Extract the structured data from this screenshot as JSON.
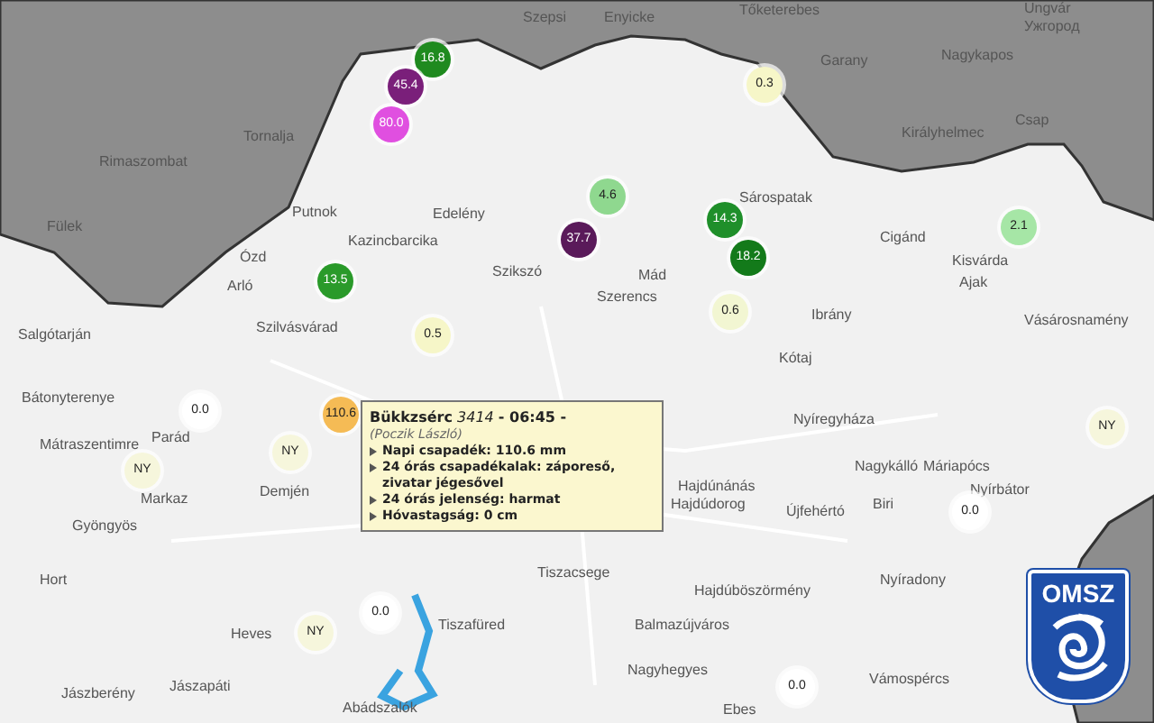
{
  "map": {
    "place_labels": [
      "Enyicke",
      "Tőketerebes",
      "Ungvár",
      "Ужгород",
      "Szepsi",
      "Garany",
      "Nagykapos",
      "Királyhelmec",
      "Csap",
      "Rimaszombat",
      "Tornalja",
      "Fülek",
      "Sárospatak",
      "Cigánd",
      "Kisvárda",
      "Ajak",
      "Putnok",
      "Edelény",
      "Kazincbarcika",
      "Ózd",
      "Arló",
      "Szikszó",
      "Mád",
      "Szerencs",
      "Salgótarján",
      "Szilvásvárad",
      "Ibrány",
      "Vásárosnamény",
      "Kótaj",
      "Bátonyterenye",
      "Mátraszentimre",
      "Parád",
      "Markaz",
      "Demjén",
      "Gyöngyös",
      "Nyíregyháza",
      "Nagykálló",
      "Máriapócs",
      "Hajdúnánás",
      "Nyírbátor",
      "Hajdúdorog",
      "Újfehértó",
      "Biri",
      "Hort",
      "Tiszacsege",
      "Hajdúböszörmény",
      "Nyíradony",
      "Heves",
      "Tiszafüred",
      "Balmazújváros",
      "Jászberény",
      "Jászapáti",
      "Nagyhegyes",
      "Vámospércs",
      "Abádszalók",
      "Ebes"
    ]
  },
  "markers": [
    {
      "value": "16.8",
      "color": "#1f8a1f"
    },
    {
      "value": "45.4",
      "color": "#7a1f7a"
    },
    {
      "value": "80.0",
      "color": "#e04fe0"
    },
    {
      "value": "0.3",
      "color": "#f6f6c8"
    },
    {
      "value": "4.6",
      "color": "#8fd88f"
    },
    {
      "value": "37.7",
      "color": "#5a1a5a"
    },
    {
      "value": "14.3",
      "color": "#1f8f2a"
    },
    {
      "value": "18.2",
      "color": "#137a1a"
    },
    {
      "value": "2.1",
      "color": "#a6e6a6"
    },
    {
      "value": "13.5",
      "color": "#2a9a2a"
    },
    {
      "value": "0.5",
      "color": "#f6f6c8"
    },
    {
      "value": "0.6",
      "color": "#f2f6d2"
    },
    {
      "value": "0.0",
      "color": "#ffffff"
    },
    {
      "value": "110.6",
      "color": "#f5bb55"
    },
    {
      "value": "NY",
      "color": "#f6f6dc"
    },
    {
      "value": "NY",
      "color": "#f6f6dc"
    },
    {
      "value": "0.0",
      "color": "#ffffff"
    },
    {
      "value": "NY",
      "color": "#f6f6dc"
    },
    {
      "value": "NY",
      "color": "#f6f6dc"
    },
    {
      "value": "0.0",
      "color": "#ffffff"
    },
    {
      "value": "0.0",
      "color": "#ffffff"
    }
  ],
  "tooltip": {
    "title": "**Bükkzsérc** *3414* **- 06:45 -**",
    "observer": "(Poczik László)",
    "items": [
      "Napi csapadék: 110.6 mm",
      "24 órás csapadékalak: záporeső, zivatar jégesővel",
      "24 órás jelenség: harmat",
      "Hóvastagság: 0 cm"
    ]
  },
  "logo": {
    "text": "OMSZ"
  }
}
